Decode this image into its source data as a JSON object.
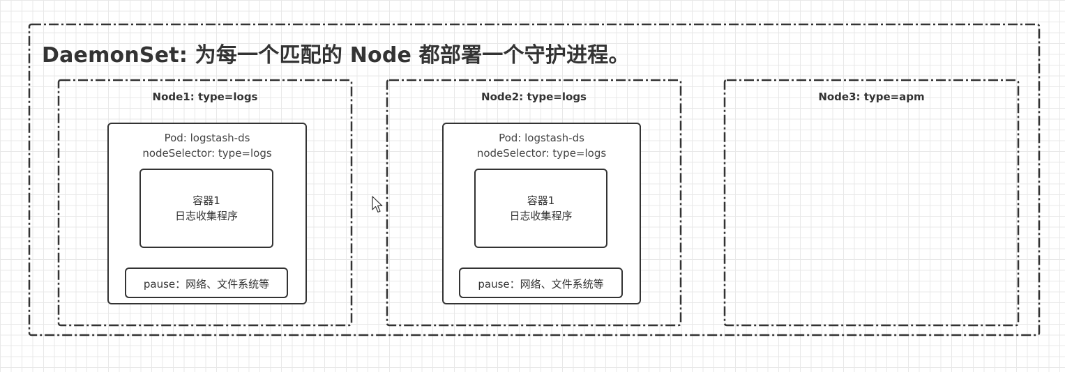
{
  "title": "DaemonSet: 为每一个匹配的 Node 都部署一个守护进程。",
  "nodes": [
    {
      "label": "Node1: type=logs",
      "pod": {
        "name": "Pod: logstash-ds",
        "selector": "nodeSelector: type=logs",
        "container_line1": "容器1",
        "container_line2": "日志收集程序",
        "pause": "pause：网络、文件系统等"
      }
    },
    {
      "label": "Node2: type=logs",
      "pod": {
        "name": "Pod: logstash-ds",
        "selector": "nodeSelector: type=logs",
        "container_line1": "容器1",
        "container_line2": "日志收集程序",
        "pause": "pause：网络、文件系统等"
      }
    },
    {
      "label": "Node3: type=apm"
    }
  ],
  "colors": {
    "stroke": "#333333",
    "grid": "#e8e8e8",
    "background": "#ffffff"
  }
}
